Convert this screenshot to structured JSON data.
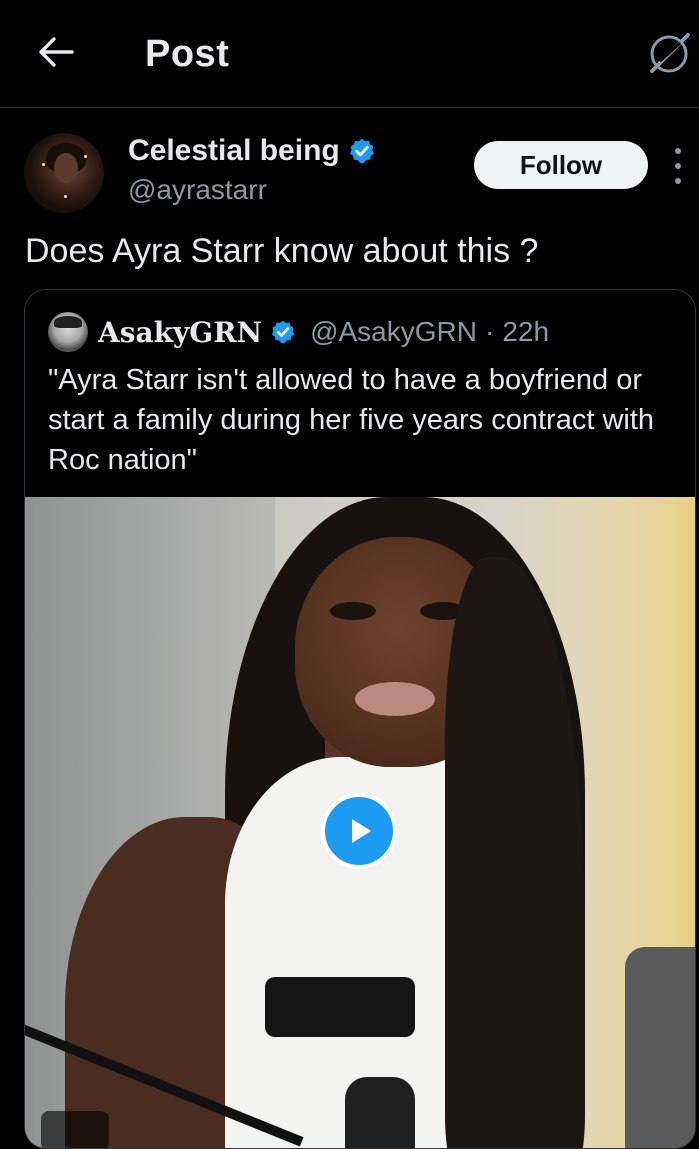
{
  "header": {
    "title": "Post",
    "back_icon": "arrow-left-icon",
    "grok_icon": "grok-icon"
  },
  "post": {
    "author": {
      "display_name": "Celestial being",
      "handle": "@ayrastarr",
      "verified": true
    },
    "follow_label": "Follow",
    "text": "Does Ayra Starr know about this ?",
    "quoted": {
      "display_name": "AsakyGRN",
      "handle": "@AsakyGRN",
      "separator": "·",
      "time": "22h",
      "verified": true,
      "text": "\"Ayra Starr isn't allowed to have a boyfriend or start a family during her five years contract with Roc nation\""
    }
  },
  "colors": {
    "background": "#000000",
    "accent": "#1d9bf0",
    "secondary_text": "#8b98a5",
    "primary_text": "#e7e9ea"
  }
}
